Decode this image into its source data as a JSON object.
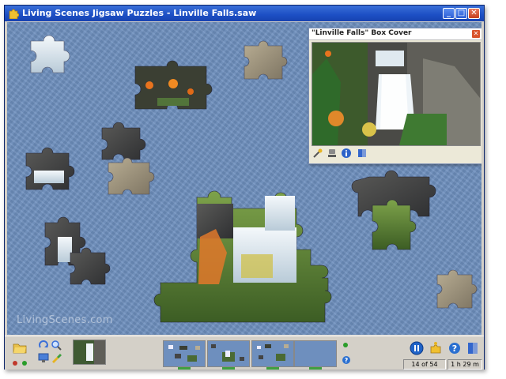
{
  "window": {
    "title": "Living Scenes Jigsaw Puzzles - Linville Falls.saw",
    "minimize_glyph": "_",
    "maximize_glyph": "□",
    "close_glyph": "✕"
  },
  "board": {
    "watermark": "LivingScenes.com",
    "background_color": "#6e8fbe"
  },
  "box_cover": {
    "title": "\"Linville Falls\" Box Cover",
    "close_glyph": "✕",
    "tools": [
      "magic-wand-icon",
      "stamp-icon",
      "info-icon",
      "book-icon"
    ]
  },
  "toolbar": {
    "icons_left": [
      "open-folder-icon",
      "rotate-icon",
      "magnify-icon",
      "monitor-icon",
      "brush-icon"
    ],
    "icons_right": [
      "pause-icon",
      "piece-helper-icon",
      "help-icon",
      "book-icon"
    ],
    "piece_count": "14 of 54",
    "elapsed_time": "1 h 29 m",
    "help_glyph": "?"
  },
  "colors": {
    "title_bar": "#1c4fc4",
    "pause_button": "#1f63c8",
    "help_button": "#2a6fd0",
    "status_green": "#2a9d2a",
    "status_red": "#c0392b"
  }
}
